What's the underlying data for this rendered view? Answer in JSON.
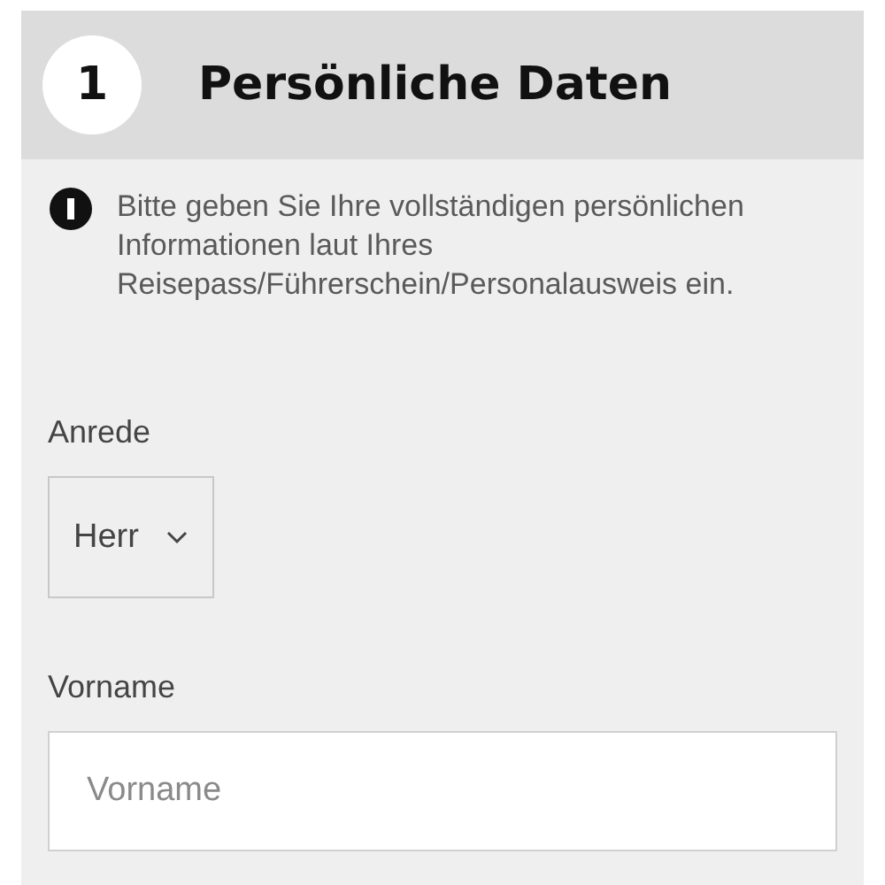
{
  "section": {
    "number": "1",
    "title": "Persönliche Daten"
  },
  "notice": "Bitte geben Sie Ihre vollständigen persönlichen Informationen laut Ihres Reisepass/Führerschein/Personalausweis ein.",
  "fields": [
    {
      "kind": "select",
      "label": "Anrede",
      "value": "Herr"
    },
    {
      "kind": "text",
      "label": "Vorname",
      "placeholder": "Vorname"
    }
  ]
}
